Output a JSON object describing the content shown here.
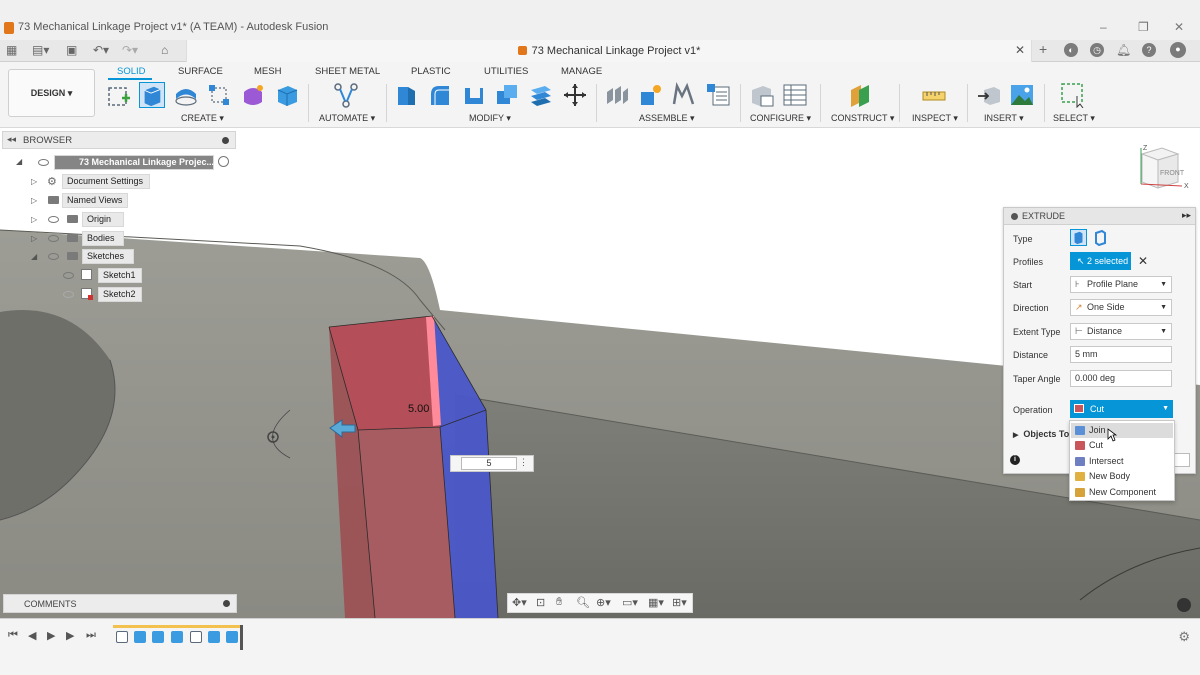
{
  "window": {
    "title": "73 Mechanical Linkage Project v1* (A TEAM) - Autodesk Fusion",
    "minimize": "–",
    "maximize": "❐",
    "close": "✕"
  },
  "doc_tab": {
    "title": "73 Mechanical Linkage Project v1*",
    "close": "✕"
  },
  "workspace": {
    "label": "DESIGN ▾"
  },
  "tabs": [
    {
      "label": "SOLID",
      "active": true
    },
    {
      "label": "SURFACE"
    },
    {
      "label": "MESH"
    },
    {
      "label": "SHEET METAL"
    },
    {
      "label": "PLASTIC"
    },
    {
      "label": "UTILITIES"
    },
    {
      "label": "MANAGE"
    }
  ],
  "groups": {
    "create": "CREATE ▾",
    "automate": "AUTOMATE ▾",
    "modify": "MODIFY ▾",
    "assemble": "ASSEMBLE ▾",
    "configure": "CONFIGURE ▾",
    "construct": "CONSTRUCT ▾",
    "inspect": "INSPECT ▾",
    "insert": "INSERT ▾",
    "select": "SELECT ▾"
  },
  "browser": {
    "title": "BROWSER",
    "root": "73 Mechanical Linkage Projec...",
    "items": [
      {
        "label": "Document Settings"
      },
      {
        "label": "Named Views"
      },
      {
        "label": "Origin"
      },
      {
        "label": "Bodies"
      },
      {
        "label": "Sketches"
      },
      {
        "label": "Sketch1"
      },
      {
        "label": "Sketch2"
      }
    ]
  },
  "viewcube": {
    "face": "FRONT",
    "z": "Z",
    "x": "X"
  },
  "viewport": {
    "dimension_label": "5.00",
    "distance_input": "5"
  },
  "extrude": {
    "title": "EXTRUDE",
    "type_label": "Type",
    "profiles_label": "Profiles",
    "profiles_value": "2 selected",
    "start_label": "Start",
    "start_value": "Profile Plane",
    "direction_label": "Direction",
    "direction_value": "One Side",
    "extent_label": "Extent Type",
    "extent_value": "Distance",
    "distance_label": "Distance",
    "distance_value": "5 mm",
    "taper_label": "Taper Angle",
    "taper_value": "0.000 deg",
    "operation_label": "Operation",
    "operation_value": "Cut",
    "objects_label": "Objects To"
  },
  "operation_options": [
    {
      "label": "Join",
      "color": "#5b8fd6"
    },
    {
      "label": "Cut",
      "color": "#c9565a"
    },
    {
      "label": "Intersect",
      "color": "#6e7fc2"
    },
    {
      "label": "New Body",
      "color": "#e0b040"
    },
    {
      "label": "New Component",
      "color": "#d8a23a"
    }
  ],
  "comments": {
    "title": "COMMENTS"
  },
  "colors": {
    "accent": "#0696d7",
    "cut_face": "#b54a55",
    "join_face": "#4a56c8",
    "model": "#8d8d85"
  }
}
